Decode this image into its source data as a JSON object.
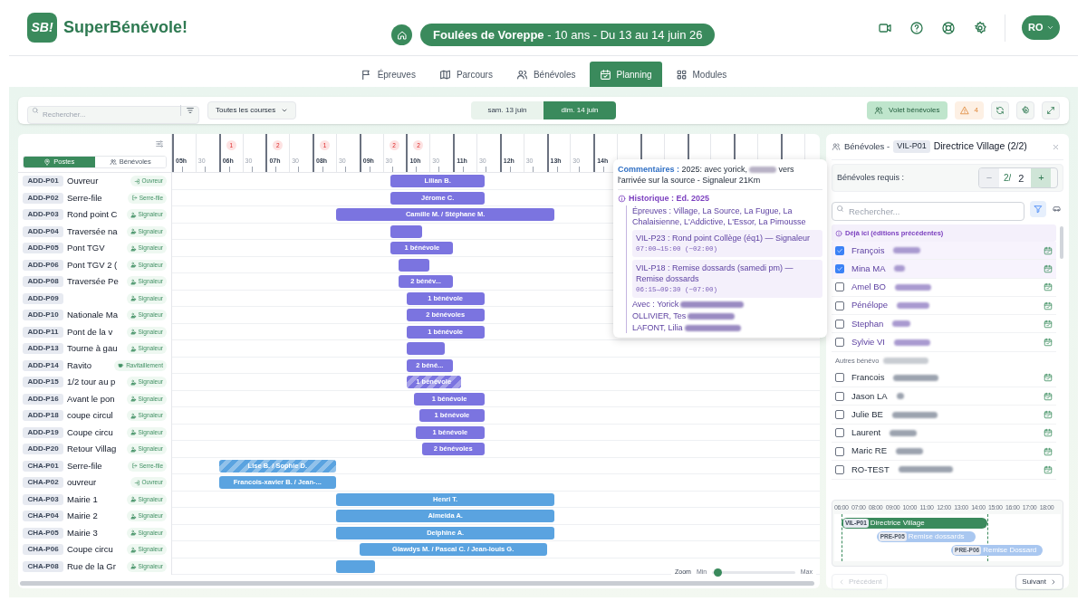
{
  "app": {
    "logo_text": "SB!",
    "name": "SuperBénévole!"
  },
  "event": {
    "title": "**Foulées de Voreppe** - 10 ans - Du 13 au 14 juin 26"
  },
  "user": {
    "initials": "RO"
  },
  "nav": [
    {
      "label": "Épreuves",
      "selected": false
    },
    {
      "label": "Parcours",
      "selected": false
    },
    {
      "label": "Bénévoles",
      "selected": false
    },
    {
      "label": "Planning",
      "selected": true
    },
    {
      "label": "Modules",
      "selected": false
    }
  ],
  "toolbar": {
    "search": {
      "placeholder": "Rechercher..."
    },
    "course_filter": "Toutes les courses",
    "days": [
      {
        "label": "sam. 13 juin",
        "selected": false
      },
      {
        "label": "dim. 14 juin",
        "selected": true
      }
    ],
    "volunteers_panel": {
      "label": "Volet bénévoles",
      "on": true
    },
    "warnings": "4"
  },
  "gantt": {
    "tabs": [
      {
        "label": "Postes",
        "selected": true
      },
      {
        "label": "Bénévoles",
        "selected": false
      }
    ],
    "slots": [
      {
        "label": "05h"
      },
      {
        "label": "30"
      },
      {
        "label": "06h",
        "alerts": "1"
      },
      {
        "label": "30"
      },
      {
        "label": "07h",
        "alerts": "2"
      },
      {
        "label": "30"
      },
      {
        "label": "08h",
        "alerts": "1"
      },
      {
        "label": "30"
      },
      {
        "label": "09h"
      },
      {
        "label": "30",
        "alerts": "2"
      },
      {
        "label": "10h",
        "alerts": "2"
      },
      {
        "label": "30"
      },
      {
        "label": "11h"
      },
      {
        "label": "30"
      },
      {
        "label": "12h"
      },
      {
        "label": "30"
      },
      {
        "label": "13h"
      },
      {
        "label": "30"
      },
      {
        "label": "14h"
      }
    ],
    "rows": [
      {
        "code": "ADD-P01",
        "name": "Ouvreur",
        "color": "#7b74e0",
        "role": {
          "kind": "ouvreur",
          "label": "Ouvreur"
        },
        "bars": [
          {
            "label": "Lilian B.",
            "striped": false
          }
        ]
      },
      {
        "code": "ADD-P02",
        "name": "Serre-file",
        "color": "#7b74e0",
        "role": {
          "kind": "serre-file",
          "label": "Serre-file"
        },
        "bars": [
          {
            "label": "Jérome C.",
            "striped": false
          }
        ]
      },
      {
        "code": "ADD-P03",
        "name": "Rond point C",
        "color": "#7b74e0",
        "role": {
          "kind": "signaleur",
          "label": "Signaleur"
        },
        "bars": [
          {
            "label": "Camille M. / Stéphane M.",
            "striped": false
          }
        ]
      },
      {
        "code": "ADD-P04",
        "name": "Traversée na",
        "color": "#7b74e0",
        "role": {
          "kind": "signaleur",
          "label": "Signaleur"
        },
        "bars": [
          {
            "striped": false
          }
        ]
      },
      {
        "code": "ADD-P05",
        "name": "Pont TGV",
        "color": "#7b74e0",
        "role": {
          "kind": "signaleur",
          "label": "Signaleur"
        },
        "bars": [
          {
            "label": "1 bénévole",
            "striped": false
          }
        ]
      },
      {
        "code": "ADD-P06",
        "name": "Pont TGV 2 (",
        "color": "#7b74e0",
        "role": {
          "kind": "signaleur",
          "label": "Signaleur"
        },
        "bars": [
          {
            "striped": false
          }
        ]
      },
      {
        "code": "ADD-P08",
        "name": "Traversée Pe",
        "color": "#7b74e0",
        "role": {
          "kind": "signaleur",
          "label": "Signaleur"
        },
        "bars": [
          {
            "label": "2 bénév...",
            "striped": false
          }
        ]
      },
      {
        "code": "ADD-P09",
        "color": "#7b74e0",
        "role": {
          "kind": "signaleur",
          "label": "Signaleur"
        },
        "bars": [
          {
            "label": "1 bénévole",
            "striped": false
          }
        ]
      },
      {
        "code": "ADD-P10",
        "name": "Nationale Ma",
        "color": "#7b74e0",
        "role": {
          "kind": "signaleur",
          "label": "Signaleur"
        },
        "bars": [
          {
            "label": "2 bénévoles",
            "striped": false
          }
        ]
      },
      {
        "code": "ADD-P11",
        "name": "Pont de la v",
        "color": "#7b74e0",
        "role": {
          "kind": "signaleur",
          "label": "Signaleur"
        },
        "bars": [
          {
            "label": "1 bénévole",
            "striped": false
          }
        ]
      },
      {
        "code": "ADD-P13",
        "name": "Tourne à gau",
        "color": "#7b74e0",
        "role": {
          "kind": "signaleur",
          "label": "Signaleur"
        },
        "bars": [
          {
            "striped": false
          }
        ]
      },
      {
        "code": "ADD-P14",
        "name": "Ravito",
        "color": "#7b74e0",
        "role": {
          "kind": "ravitaillement",
          "label": "Ravitaillement"
        },
        "bars": [
          {
            "label": "2 béné...",
            "striped": false
          }
        ]
      },
      {
        "code": "ADD-P15",
        "name": "1/2 tour au p",
        "color": "#7b74e0",
        "role": {
          "kind": "signaleur",
          "label": "Signaleur"
        },
        "bars": [
          {
            "label": "1 bénévole",
            "striped": true
          }
        ]
      },
      {
        "code": "ADD-P16",
        "name": "Avant le pon",
        "color": "#7b74e0",
        "role": {
          "kind": "signaleur",
          "label": "Signaleur"
        },
        "bars": [
          {
            "label": "1 bénévole",
            "striped": false
          }
        ]
      },
      {
        "code": "ADD-P18",
        "name": "coupe circul",
        "color": "#7b74e0",
        "role": {
          "kind": "signaleur",
          "label": "Signaleur"
        },
        "bars": [
          {
            "label": "1 bénévole",
            "striped": false
          }
        ]
      },
      {
        "code": "ADD-P19",
        "name": "Coupe circu",
        "color": "#7b74e0",
        "role": {
          "kind": "signaleur",
          "label": "Signaleur"
        },
        "bars": [
          {
            "label": "1 bénévole",
            "striped": false
          }
        ]
      },
      {
        "code": "ADD-P20",
        "name": "Retour Villag",
        "color": "#7b74e0",
        "role": {
          "kind": "signaleur",
          "label": "Signaleur"
        },
        "bars": [
          {
            "label": "2 bénévoles",
            "striped": false
          }
        ]
      },
      {
        "code": "CHA-P01",
        "name": "Serre-file",
        "color": "#5aa3e0",
        "role": {
          "kind": "serre-file",
          "label": "Serre-file"
        },
        "bars": [
          {
            "label": "Lise B. / Sophie D.",
            "striped": true
          }
        ]
      },
      {
        "code": "CHA-P02",
        "name": "ouvreur",
        "color": "#5aa3e0",
        "role": {
          "kind": "ouvreur",
          "label": "Ouvreur"
        },
        "bars": [
          {
            "label": "Francois-xavier B. / Jean-...",
            "striped": false
          }
        ]
      },
      {
        "code": "CHA-P03",
        "name": "Mairie 1",
        "color": "#5aa3e0",
        "role": {
          "kind": "signaleur",
          "label": "Signaleur"
        },
        "bars": [
          {
            "label": "Henri T.",
            "striped": false
          }
        ]
      },
      {
        "code": "CHA-P04",
        "name": "Mairie 2",
        "color": "#5aa3e0",
        "role": {
          "kind": "signaleur",
          "label": "Signaleur"
        },
        "bars": [
          {
            "label": "Almeida A.",
            "striped": false
          }
        ]
      },
      {
        "code": "CHA-P05",
        "name": "Mairie 3",
        "color": "#5aa3e0",
        "role": {
          "kind": "signaleur",
          "label": "Signaleur"
        },
        "bars": [
          {
            "label": "Delphine A.",
            "striped": false
          }
        ]
      },
      {
        "code": "CHA-P06",
        "name": "Coupe circu",
        "color": "#5aa3e0",
        "role": {
          "kind": "signaleur",
          "label": "Signaleur"
        },
        "bars": [
          {
            "label": "Glawdys M. / Pascal C. / Jean-louis G.",
            "striped": false
          }
        ]
      },
      {
        "code": "CHA-P08",
        "name": "Rue de la Gr",
        "color": "#5aa3e0",
        "role": {
          "kind": "signaleur",
          "label": "Signaleur"
        },
        "bars": [
          {
            "striped": false
          }
        ]
      }
    ],
    "zoom": {
      "label": "Zoom",
      "min": "Min",
      "max": "Max",
      "level": 0.02
    }
  },
  "popup": {
    "comment_label": "Commentaires :",
    "comment_start": "2025: avec yorick,",
    "comment_end": "vers l'arrivée sur la source - Signaleur 21Km",
    "history_title": "Historique : Ed. 2025",
    "events_line": "Épreuves : Village, La Source, La Fugue, La Chalaisienne, L'Addictive, L'Essor, La Pimousse",
    "entries": [
      {
        "title": "VIL-P23 : Rond point Collège (éq1) — Signaleur",
        "time": "07:00→15:00 (~02:00)"
      },
      {
        "title": "VIL-P18 : Remise dossards (samedi pm) — Remise dossards",
        "time": "06:15→09:30 (~07:00)"
      }
    ],
    "with_lines": [
      "Avec : Yorick",
      "OLLIVIER, Tes",
      "LAFONT, Lilia"
    ]
  },
  "panel": {
    "title": "Bénévoles -",
    "code": "VIL-P01",
    "post": "Directrice Village (2/2)",
    "required_label": "Bénévoles requis :",
    "decrement": "−",
    "assigned": "2/",
    "required": "2",
    "increment": "+",
    "search_placeholder": "Rechercher...",
    "groups": [
      {
        "kind": "history",
        "label": "Déjà ici (éditions précédentes)",
        "people": [
          {
            "name": "François",
            "checked": true
          },
          {
            "name": "Mina MA",
            "checked": true
          },
          {
            "name": "Amel BO",
            "checked": false
          },
          {
            "name": "Pénélope",
            "checked": false
          },
          {
            "name": "Stephan",
            "checked": false
          },
          {
            "name": "Sylvie VI",
            "checked": false
          }
        ]
      },
      {
        "kind": "other",
        "label": "Autres bénévo",
        "people": [
          {
            "name": "Francois",
            "checked": false
          },
          {
            "name": "Jason LA",
            "checked": false
          },
          {
            "name": "Julie BE",
            "checked": false
          },
          {
            "name": "Laurent",
            "checked": false
          },
          {
            "name": "Maric RE",
            "checked": false
          },
          {
            "name": "RO-TEST",
            "checked": false
          }
        ]
      }
    ],
    "mini_timeline": {
      "hours": [
        "06:00",
        "07:00",
        "08:00",
        "09:00",
        "10:00",
        "11:00",
        "12:00",
        "13:00",
        "14:00",
        "15:00",
        "16:00",
        "17:00",
        "18:00"
      ],
      "bars": [
        {
          "kind": "current",
          "code": "VIL-P01",
          "label": "Directrice Village"
        },
        {
          "kind": "other",
          "code": "PRE-P05",
          "label": "Remise dossards"
        },
        {
          "kind": "other",
          "code": "PRE-P06",
          "label": "Remise Dossard"
        }
      ]
    },
    "prev": {
      "label": "Précédent",
      "disabled": true
    },
    "next": {
      "label": "Suivant",
      "disabled": false
    }
  }
}
